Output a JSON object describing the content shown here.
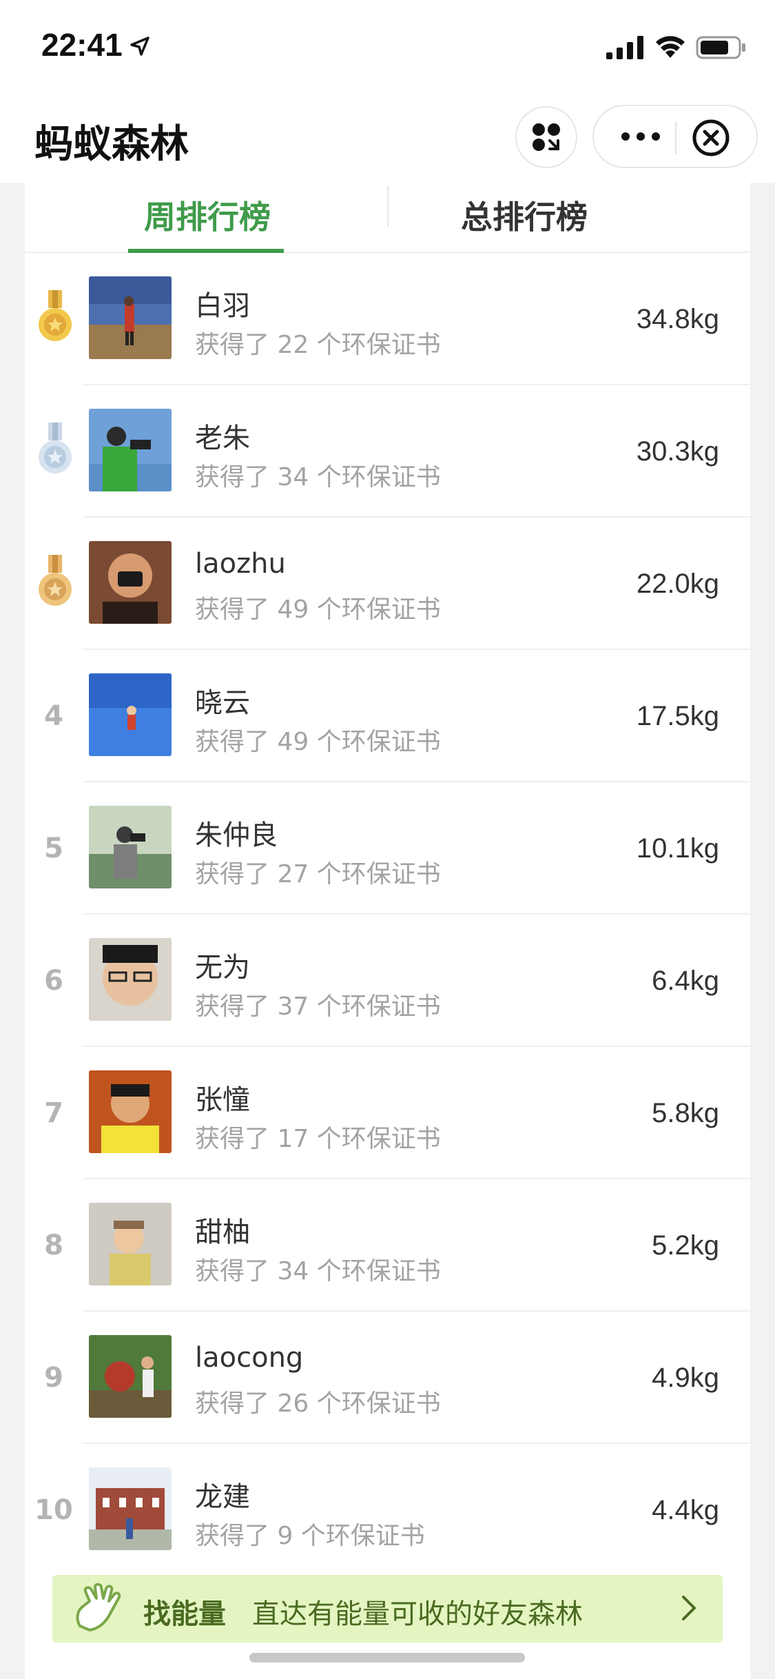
{
  "status_bar": {
    "time": "22:41",
    "icons": [
      "location-arrow-icon",
      "signal-icon",
      "wifi-icon",
      "battery-icon"
    ]
  },
  "nav": {
    "title": "蚂蚁森林",
    "icons": [
      "share-icon",
      "more-icon",
      "close-icon"
    ]
  },
  "tabs": [
    {
      "label": "周排行榜",
      "active": true
    },
    {
      "label": "总排行榜",
      "active": false
    }
  ],
  "colors": {
    "accent": "#3f9b4a",
    "banner_bg": "#e4f5c2",
    "gold": "#e8b84a",
    "silver": "#b9cde0"
  },
  "rankings": [
    {
      "rank": "1",
      "medal": "gold",
      "name": "白羽",
      "certs": "获得了 22 个环保证书",
      "weight": "34.8kg"
    },
    {
      "rank": "2",
      "medal": "silver",
      "name": "老朱",
      "certs": "获得了 34 个环保证书",
      "weight": "30.3kg"
    },
    {
      "rank": "3",
      "medal": "bronze",
      "name": "laozhu",
      "certs": "获得了 49 个环保证书",
      "weight": "22.0kg"
    },
    {
      "rank": "4",
      "medal": "",
      "name": "晓云",
      "certs": "获得了 49 个环保证书",
      "weight": "17.5kg"
    },
    {
      "rank": "5",
      "medal": "",
      "name": "朱仲良",
      "certs": "获得了 27 个环保证书",
      "weight": "10.1kg"
    },
    {
      "rank": "6",
      "medal": "",
      "name": "无为",
      "certs": "获得了 37 个环保证书",
      "weight": "6.4kg"
    },
    {
      "rank": "7",
      "medal": "",
      "name": "张憧",
      "certs": "获得了 17 个环保证书",
      "weight": "5.8kg"
    },
    {
      "rank": "8",
      "medal": "",
      "name": "甜柚",
      "certs": "获得了 34 个环保证书",
      "weight": "5.2kg"
    },
    {
      "rank": "9",
      "medal": "",
      "name": "laocong",
      "certs": "获得了 26 个环保证书",
      "weight": "4.9kg"
    },
    {
      "rank": "10",
      "medal": "",
      "name": "龙建",
      "certs": "获得了 9 个环保证书",
      "weight": "4.4kg"
    }
  ],
  "banner": {
    "title": "找能量",
    "desc": "直达有能量可收的好友森林",
    "icons": [
      "hand-icon",
      "chevron-right-icon"
    ]
  }
}
